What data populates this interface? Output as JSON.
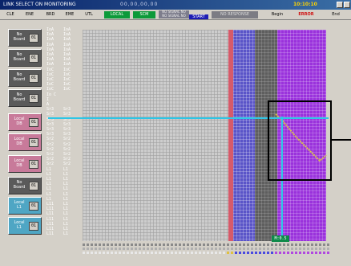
{
  "window": {
    "title": "LINK SELECT ON MONITORING",
    "center_readout": "00,00,00,00",
    "clock": "10:10:10",
    "colors": {
      "titlebar": "#0a246a",
      "clock": "#ffd400"
    }
  },
  "toolbar": {
    "menus": [
      "CLE",
      "ENE",
      "BRD",
      "EME",
      "UTL"
    ],
    "local_label": "LOCAL",
    "mode_label": "SCM",
    "status_line1": "NO SIGNAL NO",
    "status_line2": "NO SIGNAL NO",
    "start_label": "START",
    "no_response_label": "NO RESPONSE",
    "begin_label": "Begin",
    "error_label": "ERROR",
    "end_label": "End"
  },
  "left_panel": {
    "buttons": [
      {
        "label": "No Board",
        "num": "01",
        "style": "dark"
      },
      {
        "label": "No Board",
        "num": "01",
        "style": "dark"
      },
      {
        "label": "No Board",
        "num": "01",
        "style": "dark"
      },
      {
        "label": "No Board",
        "num": "01",
        "style": "dark"
      },
      {
        "label": "Local DB",
        "num": "01",
        "style": "pink"
      },
      {
        "label": "Local DB",
        "num": "01",
        "style": "pink"
      },
      {
        "label": "Local DB",
        "num": "01",
        "style": "pink"
      },
      {
        "label": "No Board",
        "num": "01",
        "style": "dark"
      },
      {
        "label": "Local L1",
        "num": "01",
        "style": "teal"
      },
      {
        "label": "Local L1",
        "num": "01",
        "style": "teal"
      }
    ]
  },
  "channel_labels": {
    "col1": [
      "IoA",
      "IoA",
      "IoA",
      "IoA",
      "IoA",
      "IoA",
      "IoA",
      "IoA",
      "IoC",
      "IoC",
      "IoC",
      "IoC",
      "IoC",
      "Io C",
      "I",
      "A",
      "Sr3",
      "Sr3",
      "Sr3",
      "Sr3",
      "Sr3",
      "Sr3",
      "Sr2",
      "Sr2",
      "Sr2",
      "Sr2",
      "Sr2",
      "Sr2",
      "L1",
      "L1",
      "L1",
      "L1",
      "L1",
      "L1",
      "L1",
      "L11",
      "L11",
      "L11",
      "L11",
      "L11",
      "L11",
      "L11"
    ],
    "col2": [
      "IoA",
      "IoA",
      "IoA",
      "IoA",
      "IoA",
      "IoA",
      "IoA",
      "IoA",
      "IoC",
      "IoC",
      "IoC",
      "IoC",
      "IoC",
      "",
      "",
      "",
      "Sr3",
      "Sr3",
      "Sr3",
      "Sr3",
      "Sr3",
      "Sr3",
      "Sr2",
      "Sr2",
      "Sr2",
      "Sr2",
      "Sr2",
      "Sr2",
      "L1",
      "L1",
      "L1",
      "L1",
      "L1",
      "L1",
      "L1",
      "L1",
      "L1",
      "L1",
      "L1",
      "L1",
      "L1",
      "L1"
    ]
  },
  "bands": {
    "colors": {
      "red": "#d65a6a",
      "blue": "#5a54c8",
      "grey": "#5e5e5e",
      "purple": "#9a32dc"
    }
  },
  "cursor": {
    "tag": "M:0.5"
  },
  "trace": {
    "color": "#d7c24a"
  }
}
